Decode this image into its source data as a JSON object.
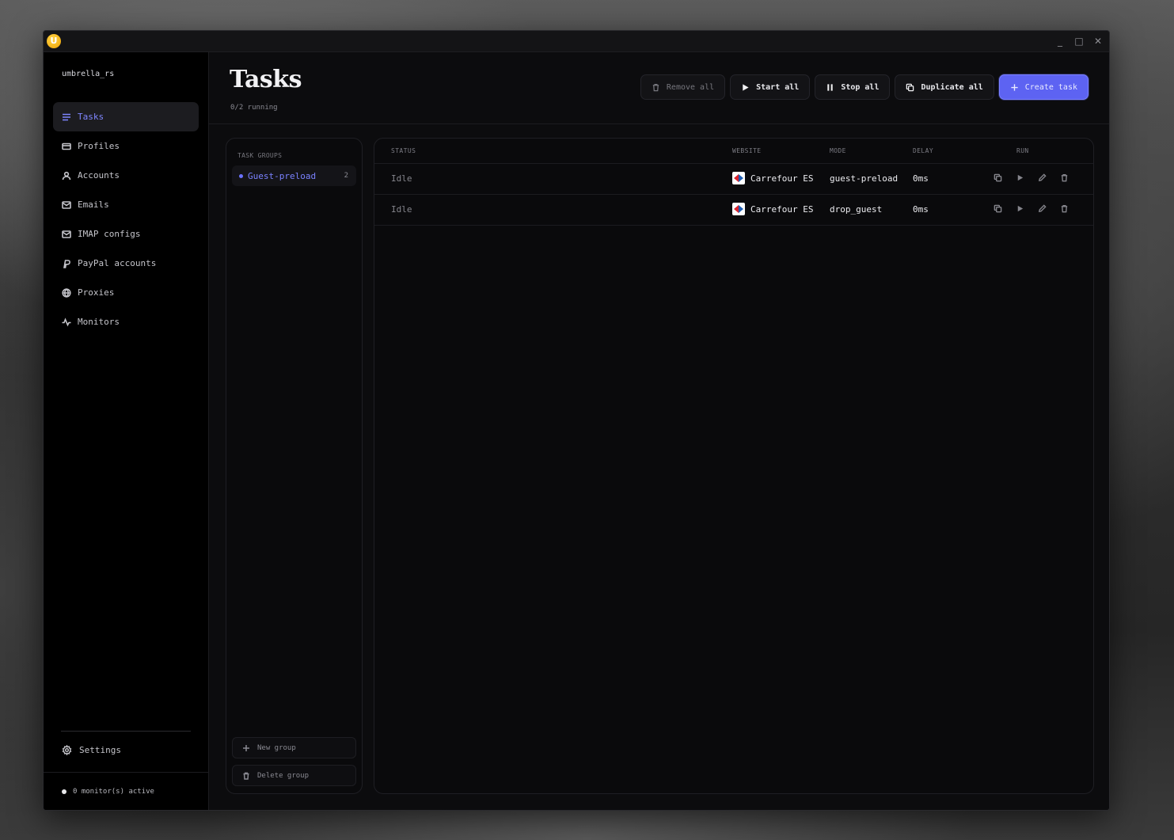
{
  "window": {
    "controls": [
      "_",
      "□",
      "✕"
    ]
  },
  "sidebar": {
    "username": "umbrella_rs",
    "items": [
      {
        "label": "Tasks",
        "icon": "list-icon",
        "active": true
      },
      {
        "label": "Profiles",
        "icon": "card-icon"
      },
      {
        "label": "Accounts",
        "icon": "user-icon"
      },
      {
        "label": "Emails",
        "icon": "mail-icon"
      },
      {
        "label": "IMAP configs",
        "icon": "inbox-icon"
      },
      {
        "label": "PayPal accounts",
        "icon": "paypal-icon"
      },
      {
        "label": "Proxies",
        "icon": "globe-icon"
      },
      {
        "label": "Monitors",
        "icon": "activity-icon"
      }
    ],
    "settings_label": "Settings",
    "monitor_status": "0 monitor(s) active"
  },
  "header": {
    "title": "Tasks",
    "running": "0/2 running",
    "buttons": {
      "remove_all": "Remove all",
      "start_all": "Start all",
      "stop_all": "Stop all",
      "duplicate_all": "Duplicate all",
      "create_task": "Create task"
    }
  },
  "groups": {
    "heading": "TASK GROUPS",
    "items": [
      {
        "name": "Guest-preload",
        "count": "2"
      }
    ],
    "new_group": "New group",
    "delete_group": "Delete group"
  },
  "table": {
    "columns": {
      "status": "STATUS",
      "website": "WEBSITE",
      "mode": "MODE",
      "delay": "DELAY",
      "run": "RUN"
    },
    "rows": [
      {
        "status": "Idle",
        "website": "Carrefour ES",
        "mode": "guest-preload",
        "delay": "0ms"
      },
      {
        "status": "Idle",
        "website": "Carrefour ES",
        "mode": "drop_guest",
        "delay": "0ms"
      }
    ]
  },
  "colors": {
    "accent": "#5d63f2",
    "accent_text": "#7a82ff",
    "background": "#0c0c0e"
  }
}
